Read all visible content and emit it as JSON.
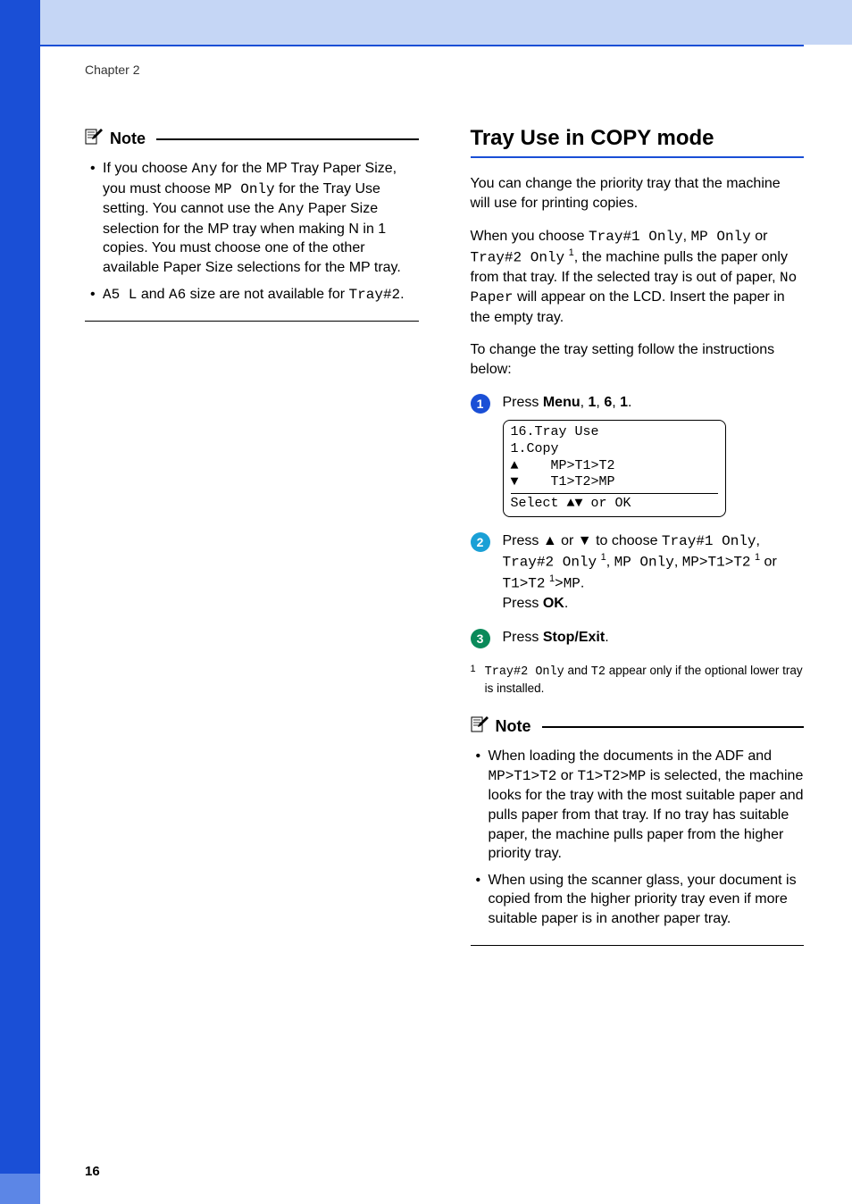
{
  "chapter": "Chapter 2",
  "page_number": "16",
  "left": {
    "note_label": "Note",
    "bullet1": {
      "p1": "If you choose ",
      "c1": "Any",
      "p2": " for the MP Tray Paper Size, you must choose ",
      "c2": "MP Only",
      "p3": " for the Tray Use setting. You cannot use the ",
      "c3": "Any",
      "p4": " Paper Size selection for the MP tray when making N in 1 copies. You must choose one of the other available Paper Size selections for the MP tray."
    },
    "bullet2": {
      "c1": "A5 L",
      "p1": " and ",
      "c2": "A6",
      "p2": " size are not available for ",
      "c3": "Tray#2",
      "p3": "."
    }
  },
  "right": {
    "heading": "Tray Use in COPY mode",
    "intro1": "You can change the priority tray that the machine will use for printing copies.",
    "intro2": {
      "p1": "When you choose ",
      "c1": "Tray#1 Only",
      "p2": ", ",
      "c2": "MP Only",
      "p3": " or ",
      "c3": "Tray#2 Only",
      "sup": "1",
      "p4": ", the machine pulls the paper only from that tray. If the selected tray is out of paper, ",
      "c4": "No Paper",
      "p5": " will appear on the LCD. Insert the paper in the empty tray."
    },
    "intro3": "To change the tray setting follow the instructions below:",
    "step1": {
      "text_pre": "Press ",
      "b1": "Menu",
      "sep1": ", ",
      "b2": "1",
      "sep2": ", ",
      "b3": "6",
      "sep3": ", ",
      "b4": "1",
      "tail": ".",
      "lcd": {
        "l1": "16.Tray Use",
        "l2": "  1.Copy",
        "l3": "a    MP>T1>T2",
        "l4": "b    T1>T2>MP",
        "footer": "Select ab or OK"
      }
    },
    "step2": {
      "p1": "Press a or b to choose ",
      "c1": "Tray#1 Only",
      "p2": ", ",
      "c2": "Tray#2 Only",
      "sup1": "1",
      "p3": ", ",
      "c3": "MP Only",
      "p4": ", ",
      "c4": "MP>T1>T2",
      "sup2": "1",
      "p5": " or ",
      "c5": "T1>T2",
      "sup3": "1",
      "p6": ">",
      "c6": "MP",
      "p7": ".",
      "press": "Press ",
      "ok": "OK",
      "tail": "."
    },
    "step3": {
      "p1": "Press ",
      "b1": "Stop/Exit",
      "p2": "."
    },
    "footnote": {
      "num": "1",
      "c1": "Tray#2 Only",
      "p1": " and ",
      "c2": "T2",
      "p2": " appear only if the optional lower tray is installed."
    },
    "note_label": "Note",
    "nb1": {
      "p1": "When loading the documents in the ADF and ",
      "c1": "MP>T1>T2",
      "p2": " or ",
      "c2": "T1>T2>MP",
      "p3": " is selected, the machine looks for the tray with the most suitable paper and pulls paper from that tray. If no tray has suitable paper, the machine pulls paper from the higher priority tray."
    },
    "nb2": "When using the scanner glass, your document is copied from the higher priority tray even if more suitable paper is in another paper tray."
  },
  "colors": {
    "step1": "#1a4fd6",
    "step2": "#1aa0d6",
    "step3": "#1a7a5a"
  }
}
